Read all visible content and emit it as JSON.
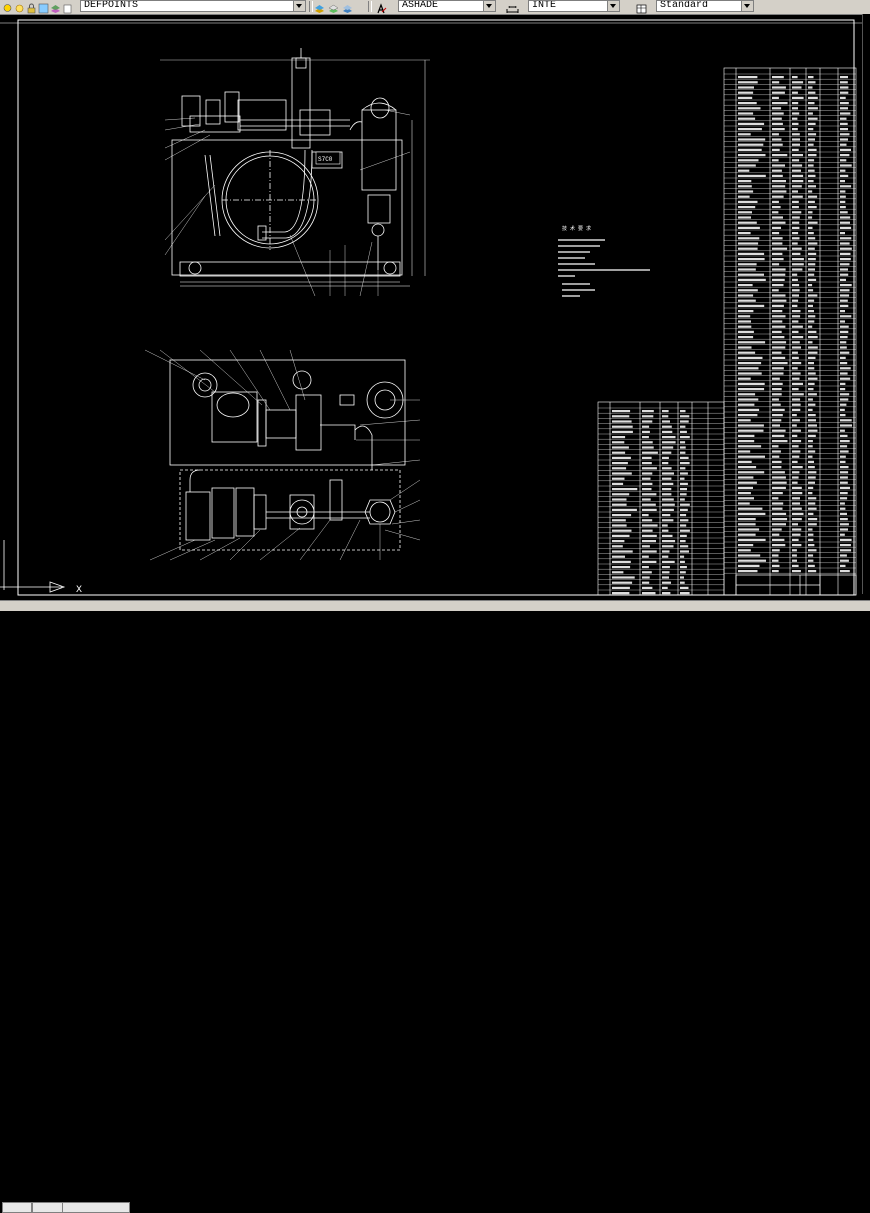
{
  "toolbar": {
    "layer_name": "DEFPOINTS",
    "text_style": "ASHADE",
    "linetype": "INTE",
    "dim_style": "Standard"
  },
  "drawing": {
    "label_top_box": "S7C0",
    "note_heading": "技 术 要 求",
    "ucs_label": "X"
  }
}
